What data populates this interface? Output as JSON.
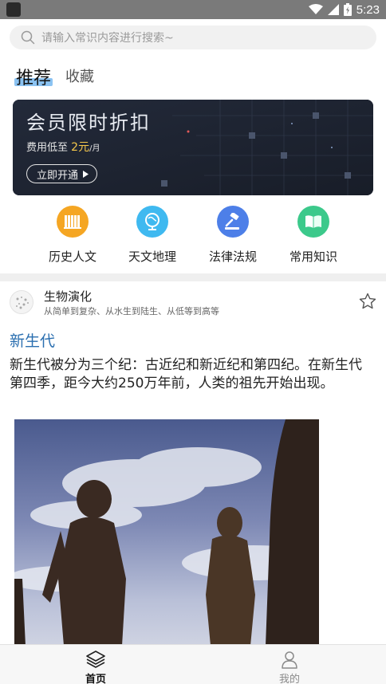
{
  "status_bar": {
    "time": "5:23"
  },
  "search": {
    "placeholder": "请输入常识内容进行搜索~"
  },
  "tabs": [
    {
      "label": "推荐"
    },
    {
      "label": "收藏"
    }
  ],
  "banner": {
    "title": "会员限时折扣",
    "subtitle_prefix": "费用低至",
    "price": "2元",
    "unit": "/月",
    "button_label": "立即开通"
  },
  "categories": [
    {
      "label": "历史人文",
      "icon": "books-icon",
      "color": "#f5a623"
    },
    {
      "label": "天文地理",
      "icon": "globe-icon",
      "color": "#3fb9f0"
    },
    {
      "label": "法律法规",
      "icon": "gavel-icon",
      "color": "#4d7fe8"
    },
    {
      "label": "常用知识",
      "icon": "book-icon",
      "color": "#3cc98b"
    }
  ],
  "card": {
    "name": "生物演化",
    "description": "从简单到复杂、从水生到陆生、从低等到高等",
    "title": "新生代",
    "body": "新生代被分为三个纪：古近纪和新近纪和第四纪。在新生代第四季，距今大约250万年前，人类的祖先开始出现。"
  },
  "bottom_nav": [
    {
      "label": "首页"
    },
    {
      "label": "我的"
    }
  ],
  "colors": {
    "accent": "#2b6fb0",
    "tab_highlight": "#8bc3f2",
    "price": "#f5c84b"
  }
}
